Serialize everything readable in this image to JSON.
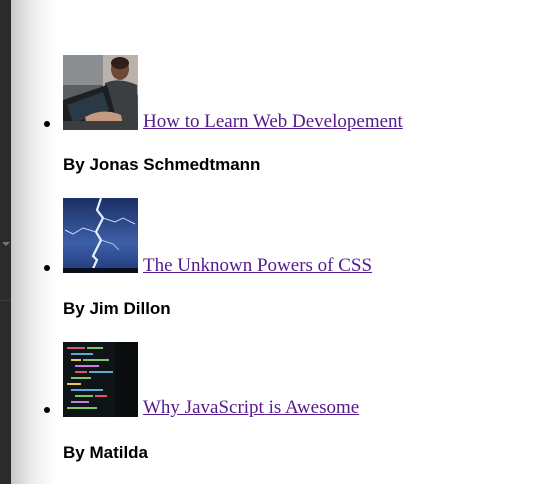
{
  "posts": [
    {
      "title": "How to Learn Web Developement",
      "author": "By Jonas Schmedtmann",
      "image_icon": "coder-laptop-photo"
    },
    {
      "title": "The Unknown Powers of CSS",
      "author": "By Jim Dillon",
      "image_icon": "lightning-storm-photo"
    },
    {
      "title": "Why JavaScript is Awesome",
      "author": "By Matilda",
      "image_icon": "code-screen-photo"
    }
  ],
  "colors": {
    "link_visited": "#551a8b",
    "text": "#000000",
    "background": "#ffffff",
    "side_panel": "#2b2b2b"
  }
}
